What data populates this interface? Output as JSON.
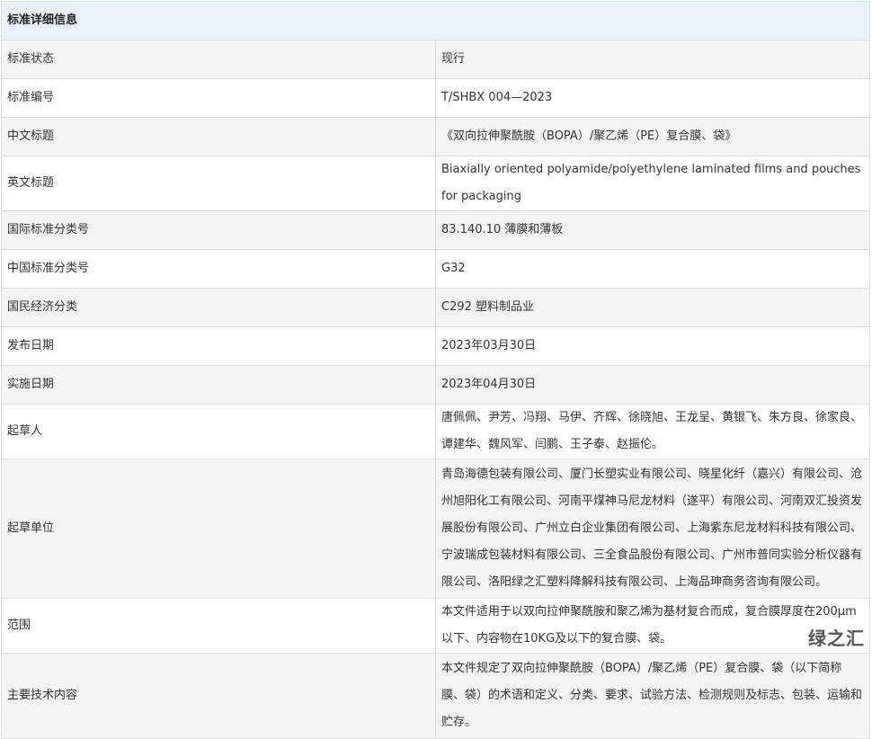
{
  "header": {
    "title": "标准详细信息"
  },
  "rows": [
    {
      "label": "标准状态",
      "value": "现行"
    },
    {
      "label": "标准编号",
      "value": "T/SHBX 004—2023"
    },
    {
      "label": "中文标题",
      "value": "《双向拉伸聚酰胺（BOPA）/聚乙烯（PE）复合膜、袋》"
    },
    {
      "label": "英文标题",
      "value": "Biaxially oriented polyamide/polyethylene laminated films and pouches for packaging"
    },
    {
      "label": "国际标准分类号",
      "value": "83.140.10 薄膜和薄板"
    },
    {
      "label": "中国标准分类号",
      "value": "G32"
    },
    {
      "label": "国民经济分类",
      "value": "C292 塑料制品业"
    },
    {
      "label": "发布日期",
      "value": "2023年03月30日"
    },
    {
      "label": "实施日期",
      "value": "2023年04月30日"
    },
    {
      "label": "起草人",
      "value": "唐佩佩、尹芳、冯翔、马伊、齐辉、徐晓旭、王龙呈、黄银飞、朱方良、徐家良、谭建华、魏风军、闫鹏、王子泰、赵振伦。"
    },
    {
      "label": "起草单位",
      "value": "青岛海德包装有限公司、厦门长塑实业有限公司、晓星化纤（嘉兴）有限公司、沧州旭阳化工有限公司、河南平煤神马尼龙材料（遂平）有限公司、河南双汇投资发展股份有限公司、广州立白企业集团有限公司、上海紫东尼龙材料科技有限公司、宁波瑞成包装材料有限公司、三全食品股份有限公司、广州市普同实验分析仪器有限公司、洛阳绿之汇塑料降解科技有限公司、上海品珅商务咨询有限公司。"
    },
    {
      "label": "范围",
      "value": "本文件适用于以双向拉伸聚酰胺和聚乙烯为基材复合而成，复合膜厚度在200μm以下、内容物在10KG及以下的复合膜、袋。"
    },
    {
      "label": "主要技术内容",
      "value": "本文件规定了双向拉伸聚酰胺（BOPA）/聚乙烯（PE）复合膜、袋（以下简称膜、袋）的术语和定义、分类、要求、试验方法、检测规则及标志、包装、运输和贮存。"
    }
  ],
  "watermark": {
    "text": "绿之汇"
  }
}
